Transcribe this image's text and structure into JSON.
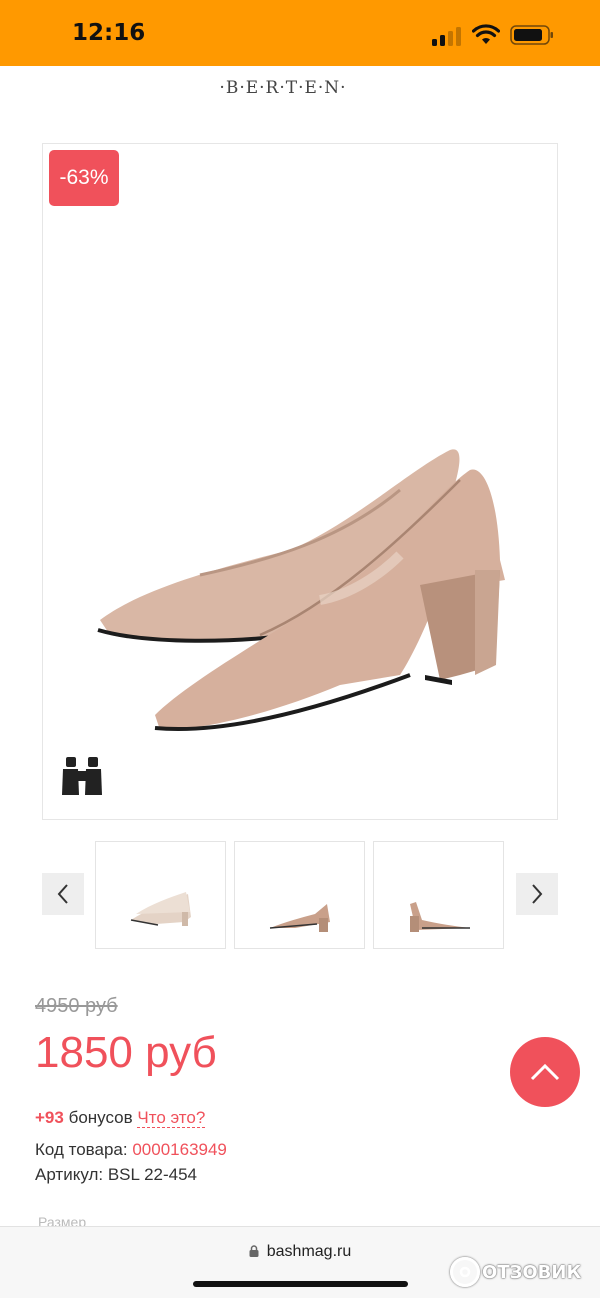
{
  "status_bar": {
    "time": "12:16",
    "background": "#ff9900"
  },
  "header": {
    "brand": "·B·E·R·T·E·N·"
  },
  "product": {
    "discount_badge": "-63%",
    "zoom_icon": "binoculars-icon",
    "thumbnails": [
      "thumbnail-1",
      "thumbnail-2",
      "thumbnail-3"
    ],
    "old_price": "4950 руб",
    "new_price": "1850 руб",
    "bonus": {
      "amount": "+93",
      "label": "бонусов",
      "link": "Что это?"
    },
    "code_label": "Код товара:",
    "code_value": "0000163949",
    "article_label": "Артикул:",
    "article_value": "BSL 22-454",
    "size_label": "Размер"
  },
  "browser": {
    "url": "bashmag.ru",
    "watermark": "ОТЗОВИК"
  },
  "colors": {
    "accent": "#f0515b",
    "shoe": "#d7b4a2"
  }
}
